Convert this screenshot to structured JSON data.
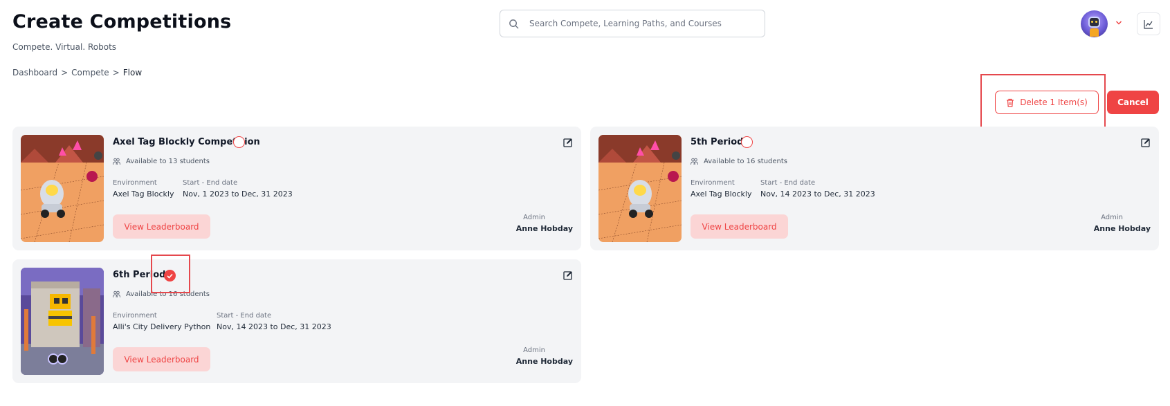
{
  "header": {
    "title": "Create Competitions",
    "subtitle": "Compete. Virtual. Robots"
  },
  "search": {
    "placeholder": "Search Compete, Learning Paths, and Courses"
  },
  "breadcrumb": {
    "items": [
      "Dashboard",
      ">",
      "Compete",
      ">",
      "Flow"
    ]
  },
  "actions": {
    "delete_label": "Delete 1 Item(s)",
    "cancel_label": "Cancel"
  },
  "colors": {
    "accent": "#ef4444",
    "card_bg": "#f3f4f6",
    "button_soft": "#fbd5d5"
  },
  "cards": [
    {
      "title": "Axel Tag Blockly Competition",
      "selected": false,
      "available": "Available to 13 students",
      "environment_label": "Environment",
      "environment": "Axel Tag Blockly",
      "dates_label": "Start - End date",
      "dates": "Nov, 1 2023 to Dec, 31 2023",
      "button": "View Leaderboard",
      "admin_label": "Admin",
      "admin": "Anne Hobday"
    },
    {
      "title": "5th Period",
      "selected": false,
      "available": "Available to 16 students",
      "environment_label": "Environment",
      "environment": "Axel Tag Blockly",
      "dates_label": "Start - End date",
      "dates": "Nov, 14 2023 to Dec, 31 2023",
      "button": "View Leaderboard",
      "admin_label": "Admin",
      "admin": "Anne Hobday"
    },
    {
      "title": "6th Period",
      "selected": true,
      "available": "Available to 16 students",
      "environment_label": "Environment",
      "environment": "Alli's City Delivery Python",
      "dates_label": "Start - End date",
      "dates": "Nov, 14 2023 to Dec, 31 2023",
      "button": "View Leaderboard",
      "admin_label": "Admin",
      "admin": "Anne Hobday"
    }
  ]
}
